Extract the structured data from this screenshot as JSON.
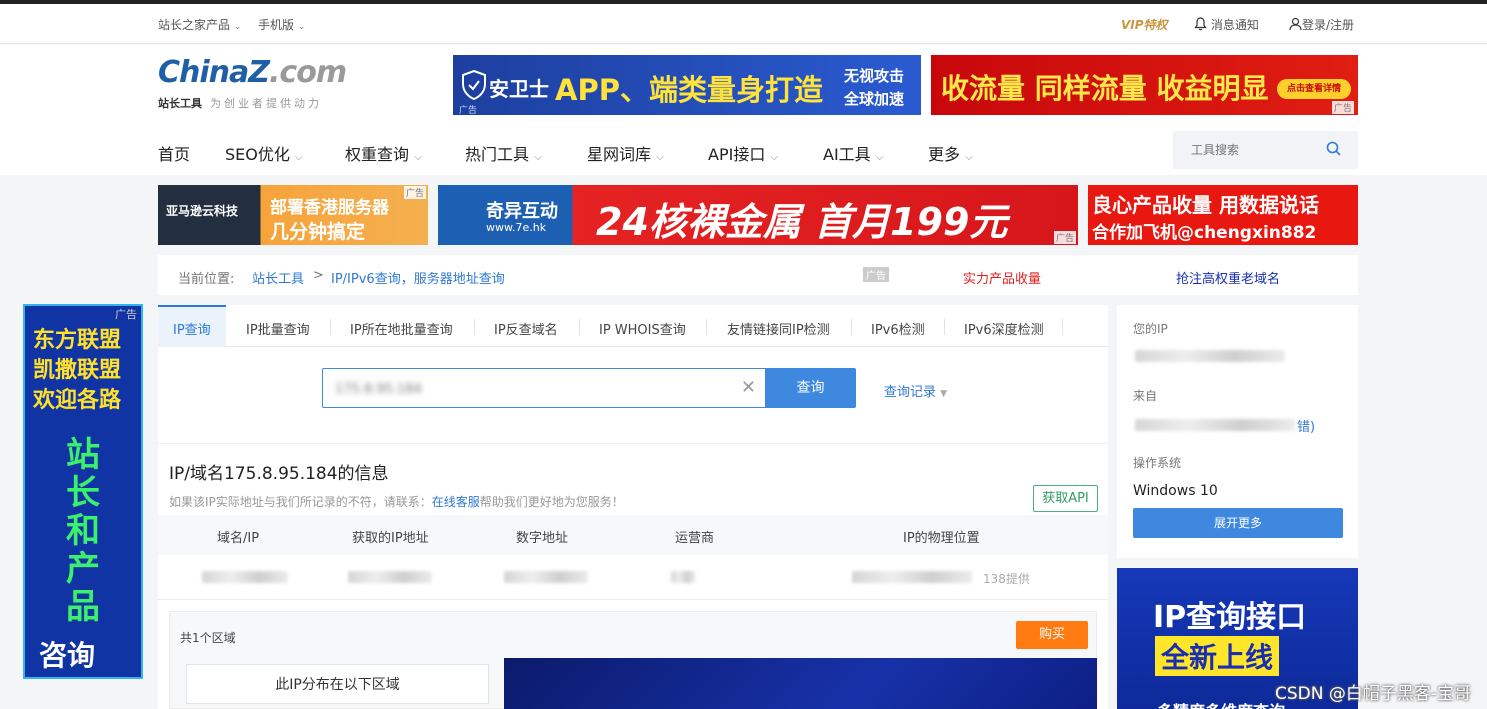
{
  "topbar": {
    "products": "站长之家产品",
    "mobile": "手机版",
    "vip": "VIP特权",
    "notifications": "消息通知",
    "login": "登录/注册"
  },
  "logo": {
    "brand_a": "China",
    "brand_b": "Z",
    "brand_c": ".com",
    "name": "站长工具",
    "slogan": "为创业者提供动力"
  },
  "ads": {
    "label": "广告",
    "top1_brand": "安卫士",
    "top1_main": "APP、端类量身打造",
    "top1_side1": "无视攻击",
    "top1_side2": "全球加速",
    "top2_main": "收流量 同样流量 收益明显",
    "top2_btn": "点击查看详情",
    "row1_brand": "亚马逊云科技",
    "row1_line1": "部署香港服务器",
    "row1_line2": "几分钟搞定",
    "row2_brand": "奇异互动",
    "row2_url": "www.7e.hk",
    "row2_main": "24核裸金属  首月199元",
    "row3_line1": "良心产品收量 用数据说话",
    "row3_line2": "合作加飞机@chengxin882",
    "left_lines": [
      "东方联盟",
      "凯撒联盟",
      "欢迎各路"
    ],
    "left_big": [
      "站",
      "长",
      "和",
      "产",
      "品"
    ],
    "left_bottom": "咨询",
    "side_line1": "IP查询接口",
    "side_line2": "全新上线",
    "side_line3": "多精度多维度查询"
  },
  "nav": {
    "items": [
      "首页",
      "SEO优化",
      "权重查询",
      "热门工具",
      "星网词库",
      "API接口",
      "AI工具",
      "更多"
    ],
    "search_placeholder": "工具搜索"
  },
  "breadcrumb": {
    "prefix": "当前位置:",
    "home": "站长工具",
    "sep": ">",
    "current": "IP/IPv6查询，服务器地址查询",
    "ad_tag": "广告",
    "link1": "实力产品收量",
    "link2": "抢注高权重老域名"
  },
  "tabs": [
    "IP查询",
    "IP批量查询",
    "IP所在地批量查询",
    "IP反查域名",
    "IP WHOIS查询",
    "友情链接同IP检测",
    "IPv6检测",
    "IPv6深度检测"
  ],
  "query": {
    "value": "175.8.95.184",
    "button": "查询",
    "history": "查询记录"
  },
  "result": {
    "title": "IP/域名175.8.95.184的信息",
    "note_before": "如果该IP实际地址与我们所记录的不符，请联系：",
    "note_link": "在线客服",
    "note_after": "帮助我们更好地为您服务！",
    "api_button": "获取API",
    "columns": [
      "域名/IP",
      "获取的IP地址",
      "数字地址",
      "运营商",
      "IP的物理位置"
    ],
    "provider_suffix": "138提供"
  },
  "region": {
    "count_label": "共1个区域",
    "buy_button": "购买",
    "distribution_label": "此IP分布在以下区域"
  },
  "sidebar": {
    "your_ip_label": "您的IP",
    "from_label": "来自",
    "from_suffix": "错)",
    "os_label": "操作系统",
    "os_value": "Windows 10",
    "more_button": "展开更多"
  },
  "watermark": "CSDN @白帽子黑客-宝哥",
  "colors": {
    "accent": "#3f88e0",
    "link": "#2f79d6",
    "buy": "#ff7a11",
    "api_green": "#2e9d5f",
    "red_link": "#e02020",
    "navy_link": "#1a2fb0"
  }
}
